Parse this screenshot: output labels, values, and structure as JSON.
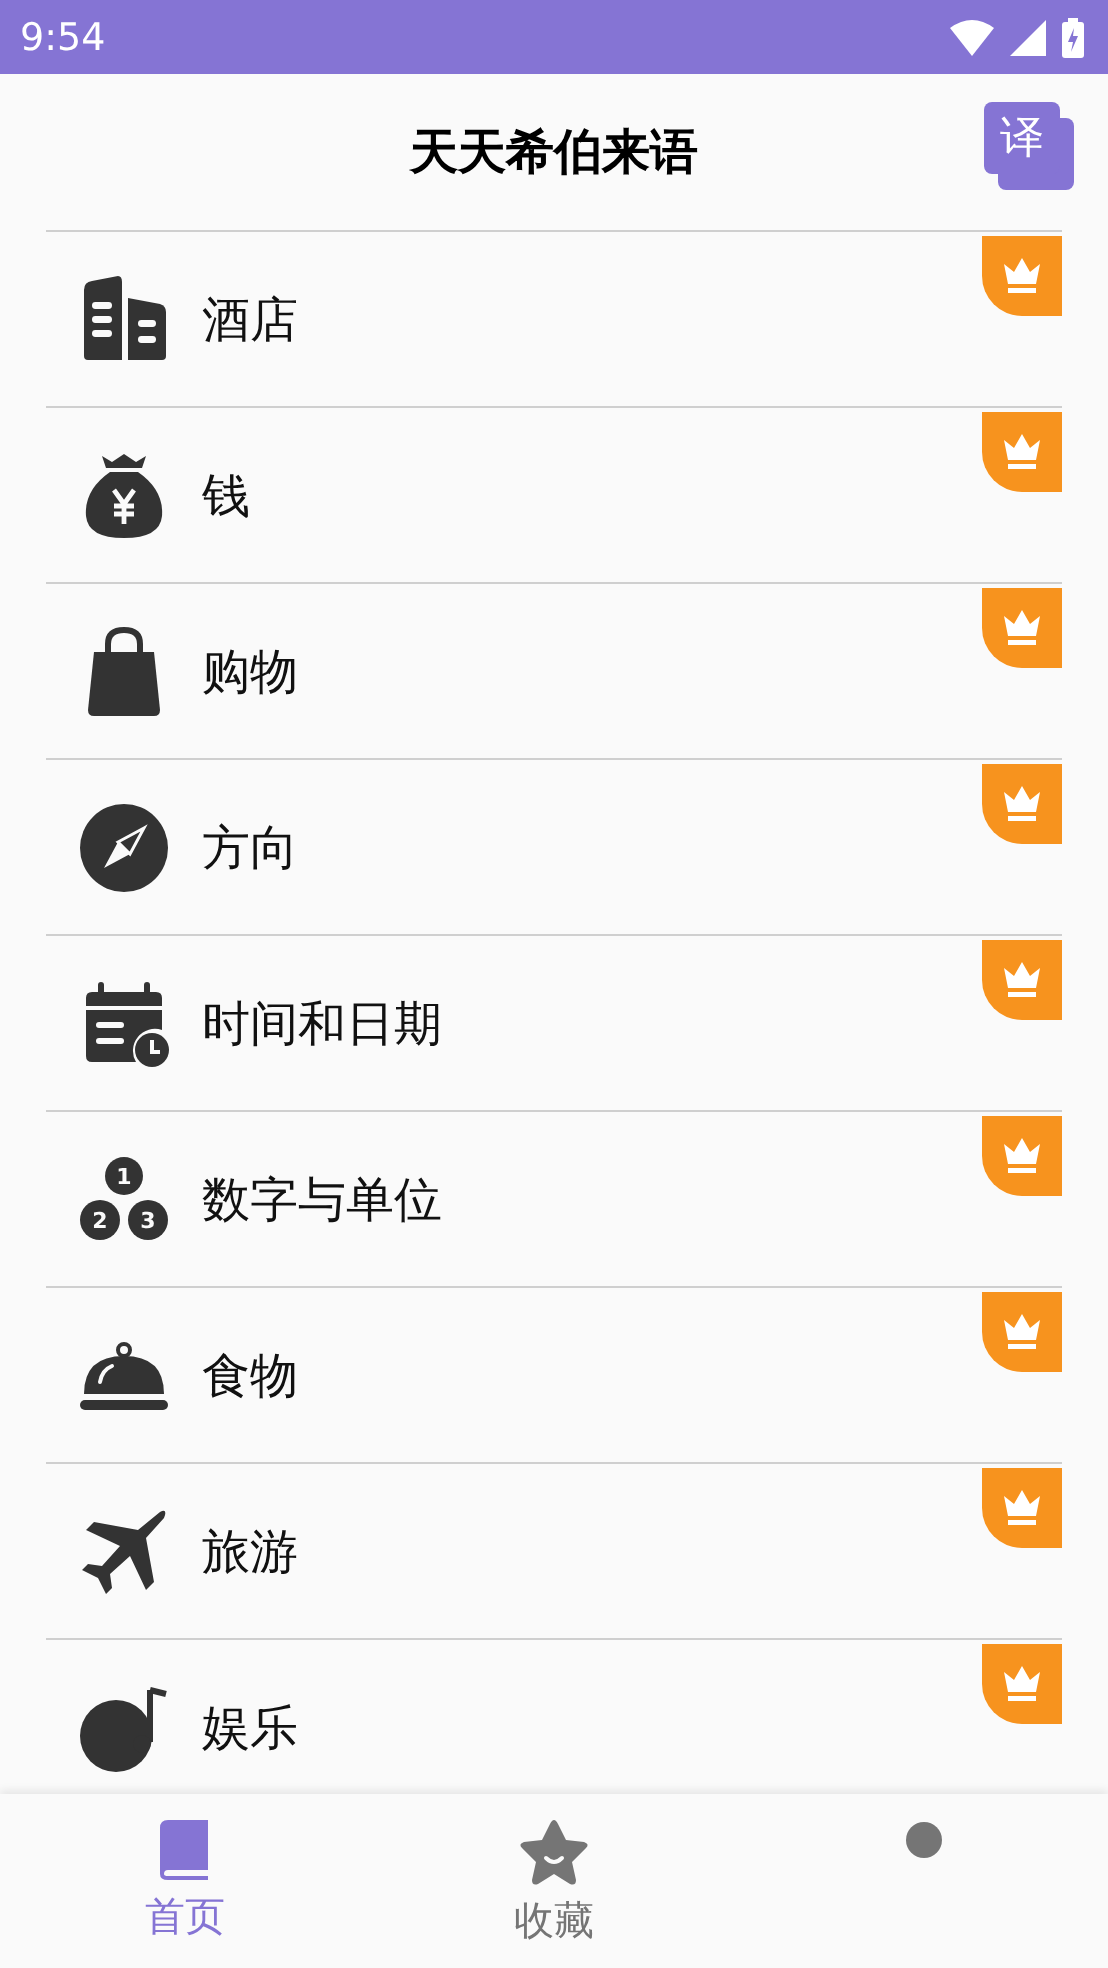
{
  "status_bar": {
    "time": "9:54"
  },
  "header": {
    "title": "天天希伯来语",
    "translate_button": "译"
  },
  "categories": [
    {
      "label": "酒店",
      "kind": "building",
      "premium": true
    },
    {
      "label": "钱",
      "kind": "moneybag",
      "premium": true
    },
    {
      "label": "购物",
      "kind": "bag",
      "premium": true
    },
    {
      "label": "方向",
      "kind": "compass",
      "premium": true
    },
    {
      "label": "时间和日期",
      "kind": "calendar",
      "premium": true
    },
    {
      "label": "数字与单位",
      "kind": "coins",
      "premium": true,
      "icon_digits": [
        "1",
        "2",
        "3"
      ]
    },
    {
      "label": "食物",
      "kind": "cloche",
      "premium": true
    },
    {
      "label": "旅游",
      "kind": "plane",
      "premium": true
    },
    {
      "label": "娱乐",
      "kind": "music",
      "premium": true
    }
  ],
  "bottom_tabs": [
    {
      "label": "首页",
      "kind": "book",
      "selected": true
    },
    {
      "label": "收藏",
      "kind": "star",
      "selected": false
    },
    {
      "kind": "dot",
      "selected": false
    }
  ]
}
